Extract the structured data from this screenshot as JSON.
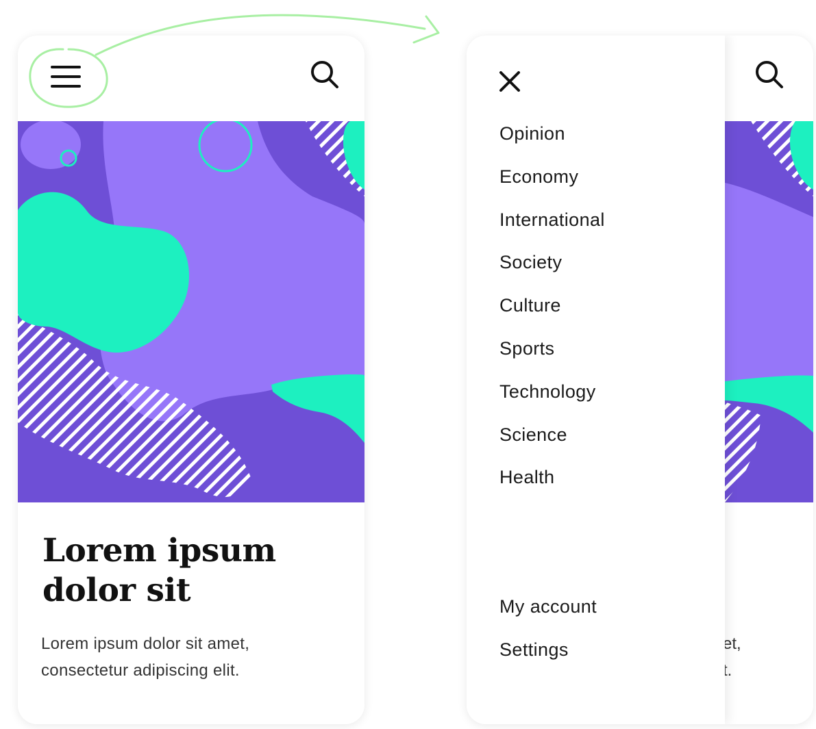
{
  "left_screen": {
    "menu_icon": "hamburger-menu-icon",
    "search_icon": "search-icon",
    "article": {
      "headline_line1": "Lorem ipsum",
      "headline_line2": "dolor sit",
      "summary_line1": "Lorem ipsum dolor sit amet,",
      "summary_line2": "consectetur adipiscing elit."
    }
  },
  "right_screen": {
    "close_icon": "close-icon",
    "search_icon": "search-icon",
    "menu": {
      "categories": [
        "Opinion",
        "Economy",
        "International",
        "Society",
        "Culture",
        "Sports",
        "Technology",
        "Science",
        "Health"
      ],
      "account": [
        "My account",
        "Settings"
      ]
    },
    "peek_summary_line1": "et,",
    "peek_summary_line2": "t."
  },
  "colors": {
    "purple_dark": "#6E4FD6",
    "purple_light": "#9676F9",
    "mint": "#1DF0C0",
    "annotation_green": "#A8EFA3"
  }
}
